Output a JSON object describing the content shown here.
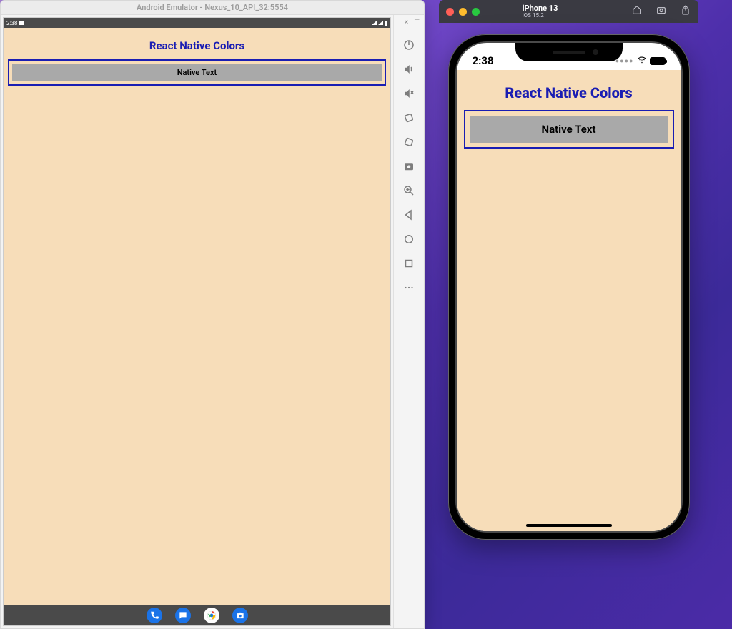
{
  "android": {
    "window_title": "Android Emulator - Nexus_10_API_32:5554",
    "status": {
      "time": "2:38"
    },
    "app": {
      "title": "React Native Colors",
      "native_text": "Native Text"
    },
    "toolbar": {
      "close": "×",
      "minimize": "—"
    },
    "taskbar": {
      "phone": "phone",
      "messages": "messages",
      "chrome": "chrome",
      "camera": "camera"
    }
  },
  "ios": {
    "titlebar": {
      "device": "iPhone 13",
      "os_version": "iOS 15.2"
    },
    "status": {
      "time": "2:38",
      "signal": "●●●●"
    },
    "app": {
      "title": "React Native Colors",
      "native_text": "Native Text"
    }
  },
  "colors": {
    "app_bg": "#f7ddb9",
    "accent_blue": "#1a1db3",
    "box_gray": "#a9a9a9"
  }
}
